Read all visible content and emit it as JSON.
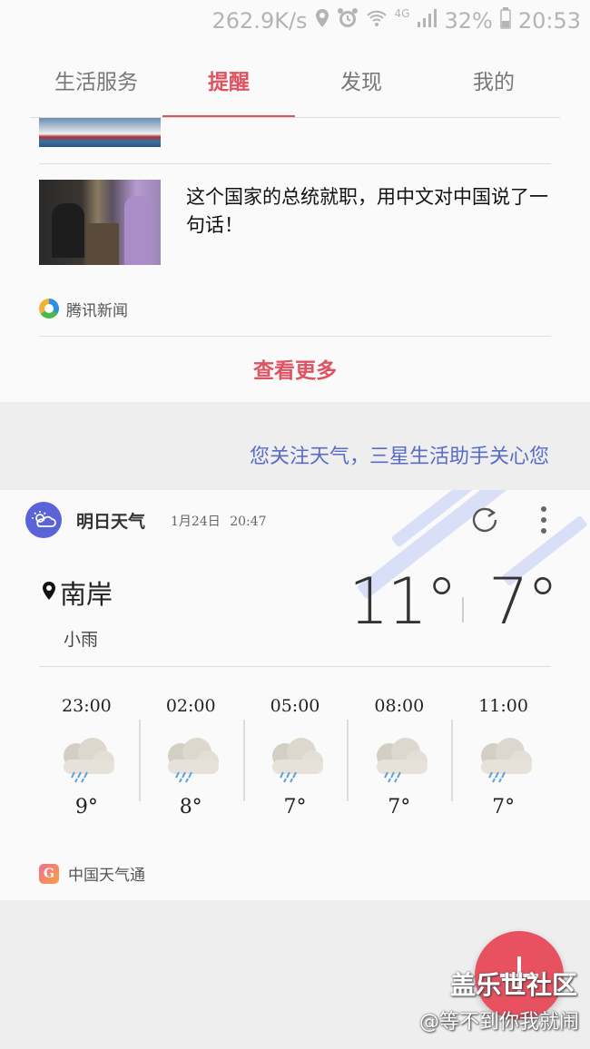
{
  "status_bar": {
    "net_speed": "262.9K/s",
    "network": "4G",
    "battery": "32%",
    "time": "20:53"
  },
  "tabs": [
    {
      "label": "生活服务"
    },
    {
      "label": "提醒"
    },
    {
      "label": "发现"
    },
    {
      "label": "我的"
    }
  ],
  "news": {
    "title": "这个国家的总统就职，用中文对中国说了一句话！",
    "source": "腾讯新闻",
    "more_label": "查看更多"
  },
  "slogan": "您关注天气，三星生活助手关心您",
  "weather": {
    "card_title": "明日天气",
    "date": "1月24日",
    "time": "20:47",
    "city": "南岸",
    "condition": "小雨",
    "temp_high": "11°",
    "temp_low": "7°",
    "hourly": [
      {
        "time": "23:00",
        "temp": "9°",
        "icon": "rain-cloud-icon"
      },
      {
        "time": "02:00",
        "temp": "8°",
        "icon": "rain-cloud-icon"
      },
      {
        "time": "05:00",
        "temp": "7°",
        "icon": "rain-cloud-icon"
      },
      {
        "time": "08:00",
        "temp": "7°",
        "icon": "rain-cloud-icon"
      },
      {
        "time": "11:00",
        "temp": "7°",
        "icon": "rain-cloud-icon"
      }
    ],
    "source": "中国天气通"
  },
  "watermark": {
    "site": "盖乐世社区",
    "user": "@等不到你我就闹"
  },
  "colors": {
    "accent": "#e05262",
    "slogan": "#5a6bc8",
    "weather_logo": "#5b63d8"
  }
}
